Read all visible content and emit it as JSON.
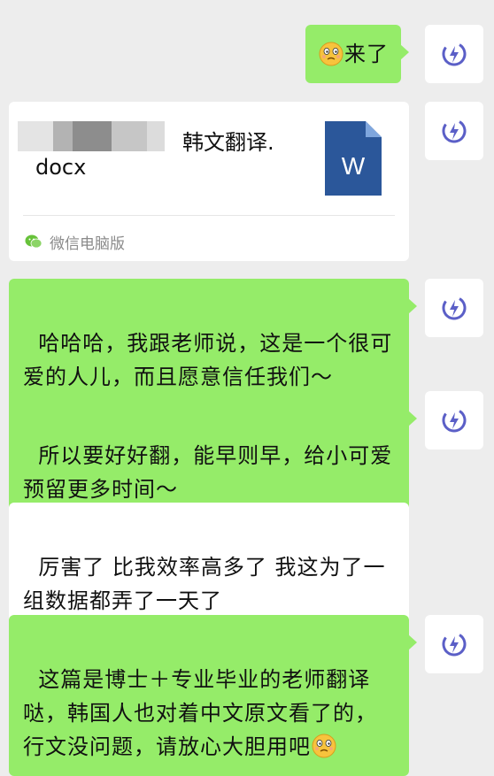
{
  "colors": {
    "sent_bubble": "#95ec69",
    "received_bubble": "#ffffff",
    "background": "#ededed",
    "word_blue": "#2b579a"
  },
  "messages": [
    {
      "type": "sent",
      "text": "来了",
      "emoji": "pensive-face-emoji"
    },
    {
      "type": "file",
      "file_name_line1": "韩文翻译.",
      "file_name_line2": "docx",
      "file_icon_letter": "W",
      "source_app": "微信电脑版"
    },
    {
      "type": "sent",
      "text": "哈哈哈，我跟老师说，这是一个很可爱的人儿，而且愿意信任我们～"
    },
    {
      "type": "sent",
      "text": "所以要好好翻，能早则早，给小可爱预留更多时间～"
    },
    {
      "type": "received",
      "text": "厉害了 比我效率高多了 我这为了一组数据都弄了一天了"
    },
    {
      "type": "sent",
      "text": "这篇是博士＋专业毕业的老师翻译哒，韩国人也对着中文原文看了的，行文没问题，请放心大胆用吧",
      "emoji": "pensive-face-emoji"
    }
  ]
}
